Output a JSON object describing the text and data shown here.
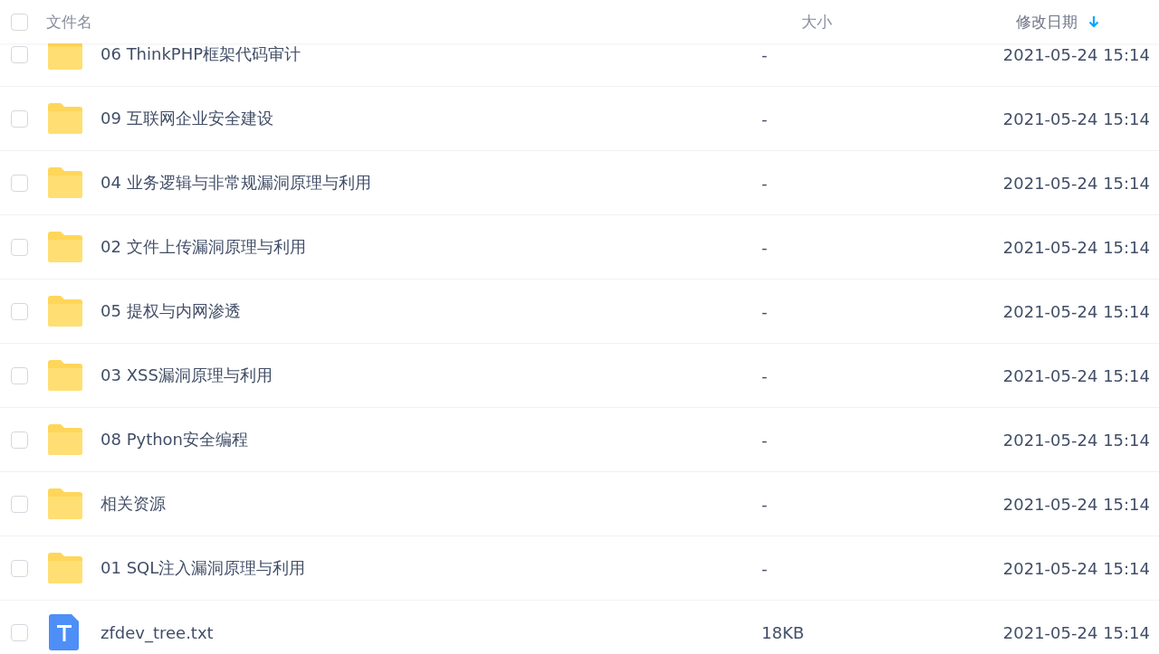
{
  "header": {
    "checked": false,
    "columns": [
      {
        "label": "文件名",
        "sorted": false
      },
      {
        "label": "大小",
        "sorted": false
      },
      {
        "label": "修改日期",
        "sorted": true
      }
    ]
  },
  "rows": [
    {
      "kind": "folder",
      "name": "06 ThinkPHP框架代码审计",
      "size": "-",
      "date": "2021-05-24 15:14",
      "checked": false
    },
    {
      "kind": "folder",
      "name": "09 互联网企业安全建设",
      "size": "-",
      "date": "2021-05-24 15:14",
      "checked": false
    },
    {
      "kind": "folder",
      "name": "04 业务逻辑与非常规漏洞原理与利用",
      "size": "-",
      "date": "2021-05-24 15:14",
      "checked": false
    },
    {
      "kind": "folder",
      "name": "02 文件上传漏洞原理与利用",
      "size": "-",
      "date": "2021-05-24 15:14",
      "checked": false
    },
    {
      "kind": "folder",
      "name": "05 提权与内网渗透",
      "size": "-",
      "date": "2021-05-24 15:14",
      "checked": false
    },
    {
      "kind": "folder",
      "name": "03 XSS漏洞原理与利用",
      "size": "-",
      "date": "2021-05-24 15:14",
      "checked": false
    },
    {
      "kind": "folder",
      "name": "08 Python安全编程",
      "size": "-",
      "date": "2021-05-24 15:14",
      "checked": false
    },
    {
      "kind": "folder",
      "name": "相关资源",
      "size": "-",
      "date": "2021-05-24 15:14",
      "checked": false
    },
    {
      "kind": "folder",
      "name": "01 SQL注入漏洞原理与利用",
      "size": "-",
      "date": "2021-05-24 15:14",
      "checked": false
    },
    {
      "kind": "text",
      "name": "zfdev_tree.txt",
      "size": "18KB",
      "date": "2021-05-24 15:14",
      "checked": false
    }
  ]
}
